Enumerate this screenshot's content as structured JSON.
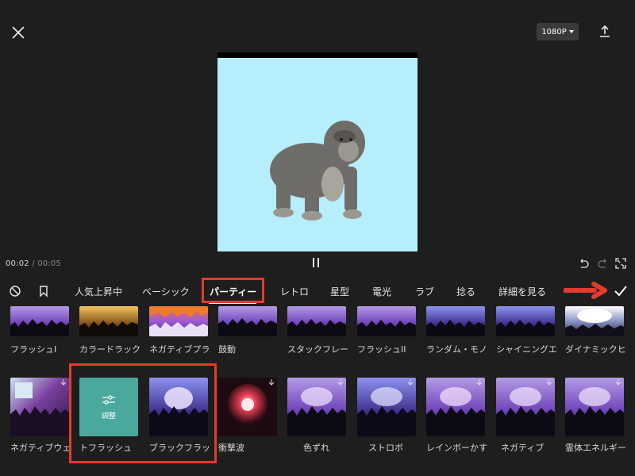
{
  "header": {
    "resolution": "1080P",
    "icons": [
      "close-icon",
      "export-icon",
      "chevron-down-icon"
    ]
  },
  "playback": {
    "current_time": "00:02",
    "separator": "/",
    "total_time": "00:05"
  },
  "tabs": {
    "items": [
      {
        "label": "人気上昇中"
      },
      {
        "label": "ベーシック"
      },
      {
        "label": "パーティー"
      },
      {
        "label": "レトロ"
      },
      {
        "label": "星型"
      },
      {
        "label": "電光"
      },
      {
        "label": "ラブ"
      },
      {
        "label": "捻る"
      },
      {
        "label": "詳細を見る"
      }
    ],
    "active": "パーティー"
  },
  "effects_row1": [
    {
      "label": "フラッシュI"
    },
    {
      "label": "カラードラック"
    },
    {
      "label": "ネガティブプラ"
    },
    {
      "label": "鼓動"
    },
    {
      "label": "スタックフレー"
    },
    {
      "label": "フラッシュII"
    },
    {
      "label": "ランダム・モノ"
    },
    {
      "label": "シャイニングエ"
    },
    {
      "label": "ダイナミックヒ"
    }
  ],
  "effects_row2": [
    {
      "label": "ネガティブウェ"
    },
    {
      "label": "トフラッシュ",
      "thumb_text": "調整"
    },
    {
      "label": "ブラックフラッ"
    },
    {
      "label": "衝撃波"
    },
    {
      "label": "色ずれ"
    },
    {
      "label": "ストロボ"
    },
    {
      "label": "レインボーかす"
    },
    {
      "label": "ネガティブ"
    },
    {
      "label": "霊体エネルギー"
    }
  ],
  "colors": {
    "background": "#1e1e1f",
    "highlight_box": "#e43b2e",
    "preview_sky": "#b6eefc",
    "adjust_tile": "#4aa99c"
  }
}
